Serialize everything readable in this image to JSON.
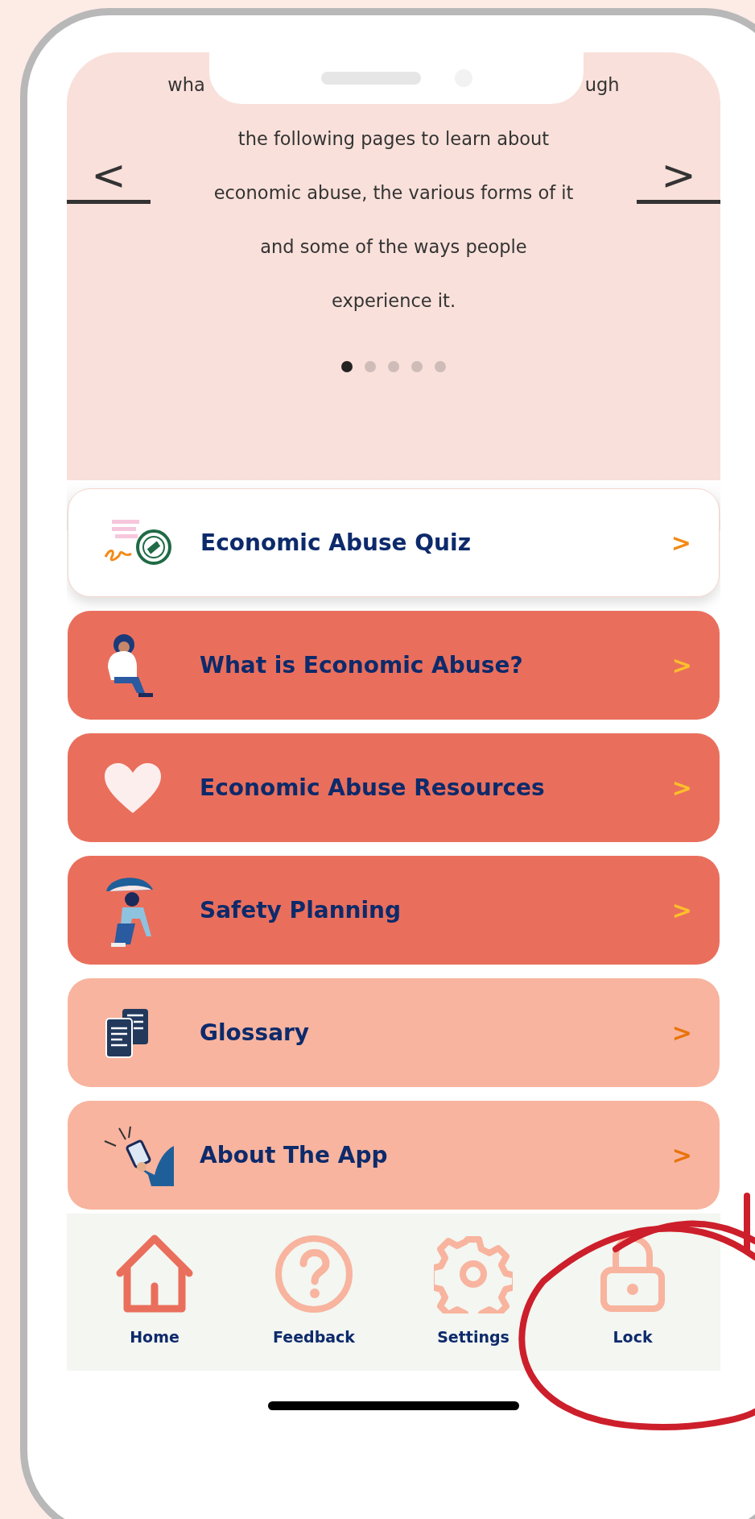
{
  "intro": {
    "lines": [
      [
        "wha",
        "ugh"
      ],
      [
        "the following pages to learn about"
      ],
      [
        "economic abuse, the various forms of it"
      ],
      [
        "and some of the ways people"
      ],
      [
        "experience it."
      ]
    ],
    "prev": "<",
    "next": ">",
    "pages": [
      {
        "selected": true
      },
      {
        "selected": false
      },
      {
        "selected": false
      },
      {
        "selected": false
      },
      {
        "selected": false
      }
    ]
  },
  "menu": [
    {
      "label": "Economic Abuse Quiz",
      "kind": "featured",
      "chevron": ">"
    },
    {
      "label": "What is Economic Abuse?",
      "kind": "primary",
      "chevron": ">"
    },
    {
      "label": "Economic Abuse Resources",
      "kind": "primary",
      "chevron": ">"
    },
    {
      "label": "Safety Planning",
      "kind": "primary",
      "chevron": ">"
    },
    {
      "label": "Glossary",
      "kind": "secondary",
      "chevron": ">"
    },
    {
      "label": "About The App",
      "kind": "secondary",
      "chevron": ">"
    }
  ],
  "nav": [
    {
      "label": "Home",
      "selected": true
    },
    {
      "label": "Feedback",
      "selected": false
    },
    {
      "label": "Settings",
      "selected": false
    },
    {
      "label": "Lock",
      "selected": false
    }
  ]
}
